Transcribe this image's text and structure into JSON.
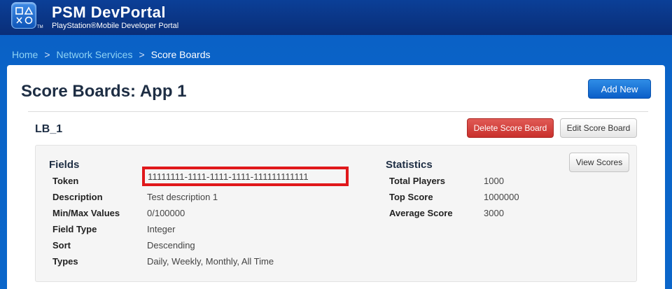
{
  "header": {
    "brand_title": "PSM DevPortal",
    "brand_subtitle": "PlayStation®Mobile Developer Portal",
    "tm": "TM"
  },
  "breadcrumb": {
    "items": [
      "Home",
      "Network Services",
      "Score Boards"
    ],
    "separator": ">"
  },
  "page": {
    "title": "Score Boards: App 1",
    "add_new_label": "Add New"
  },
  "leaderboard": {
    "name": "LB_1",
    "delete_label": "Delete Score Board",
    "edit_label": "Edit Score Board",
    "view_scores_label": "View Scores",
    "fields_heading": "Fields",
    "fields": [
      {
        "label": "Token",
        "value": "11111111-1111-1111-1111-111111111111"
      },
      {
        "label": "Description",
        "value": "Test description 1"
      },
      {
        "label": "Min/Max Values",
        "value": "0/100000"
      },
      {
        "label": "Field Type",
        "value": "Integer"
      },
      {
        "label": "Sort",
        "value": "Descending"
      },
      {
        "label": "Types",
        "value": "Daily, Weekly, Monthly, All Time"
      }
    ],
    "statistics_heading": "Statistics",
    "statistics": [
      {
        "label": "Total Players",
        "value": "1000"
      },
      {
        "label": "Top Score",
        "value": "1000000"
      },
      {
        "label": "Average Score",
        "value": "3000"
      }
    ]
  },
  "colors": {
    "header_bg": "#0a2e78",
    "body_bg": "#0b66ca",
    "primary_button": "#0b5ec8",
    "danger_button": "#c9302c",
    "highlight_border": "#e0181b",
    "breadcrumb_link": "#8fd3f4"
  }
}
